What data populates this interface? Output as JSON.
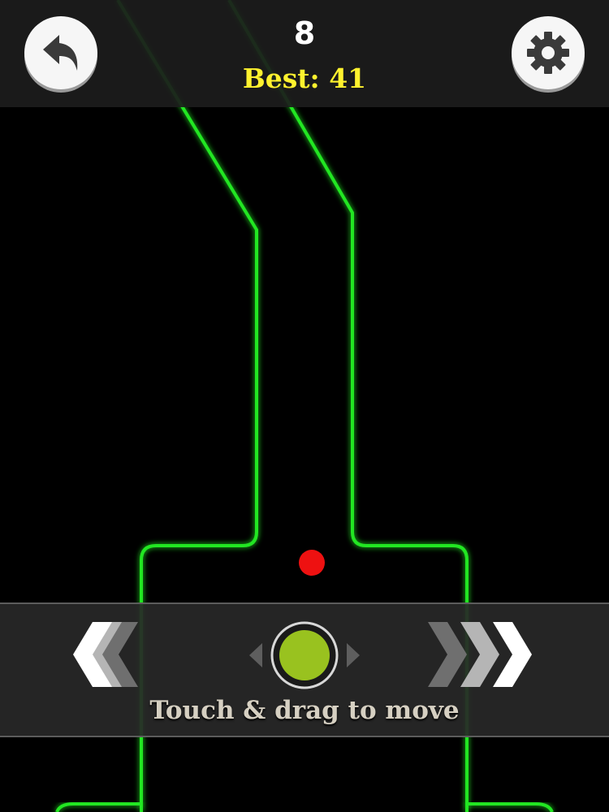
{
  "hud": {
    "score": "8",
    "best": "Best: 41"
  },
  "controls": {
    "instruction": "Touch & drag to move"
  },
  "icons": {
    "back": "undo-arrow-icon",
    "settings": "gear-icon",
    "left": "chevrons-left-icon",
    "right": "chevrons-right-icon",
    "handle": "drag-handle-icon"
  },
  "colors": {
    "background": "#000000",
    "track": "#22e622",
    "ball": "#ee1111",
    "best_text": "#fff22e",
    "handle": "#99c21f"
  }
}
